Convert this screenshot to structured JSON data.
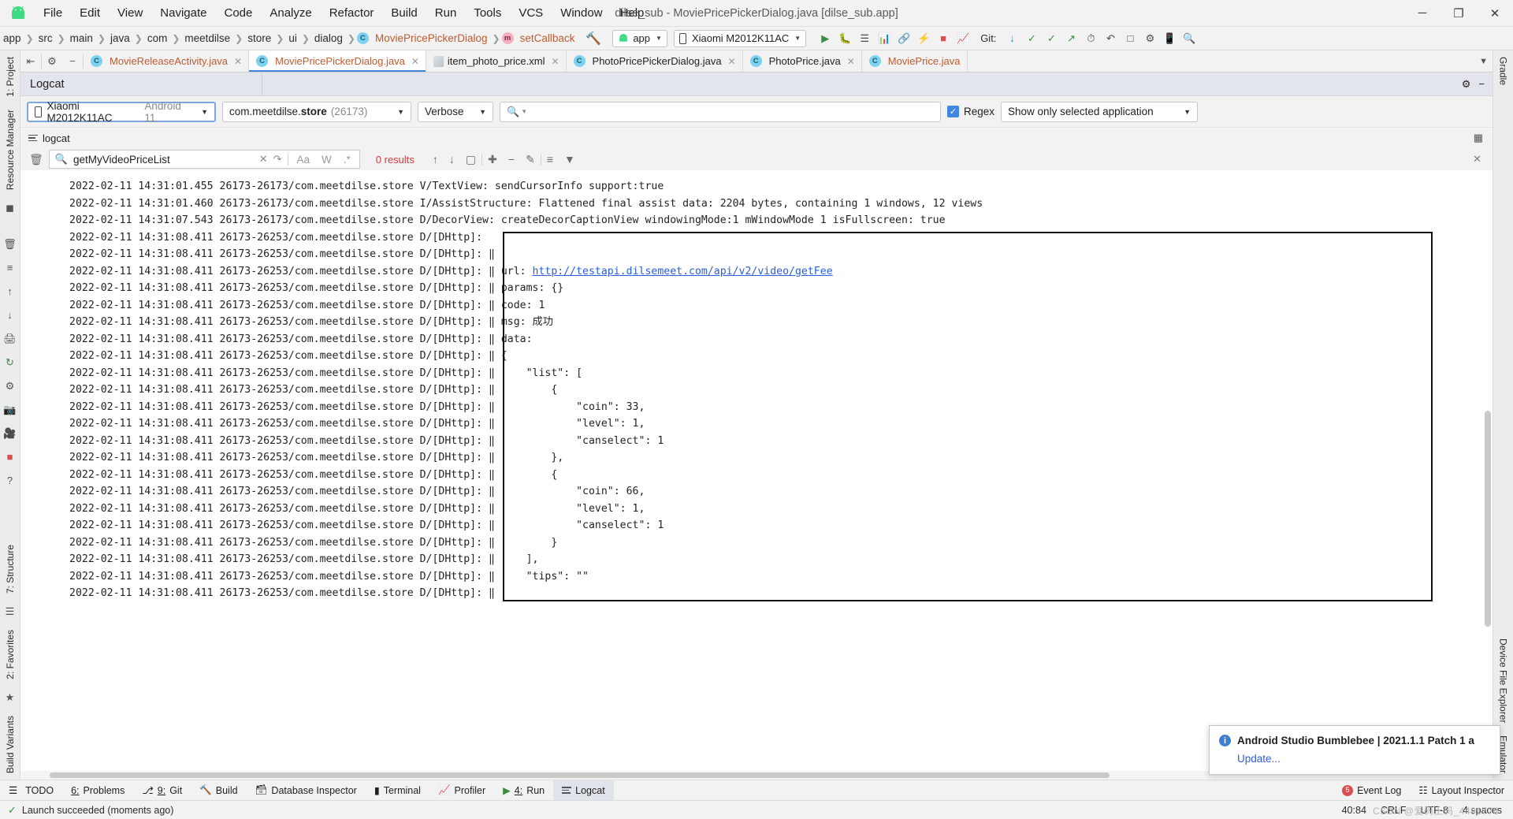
{
  "window": {
    "title": "dilse_sub - MoviePricePickerDialog.java [dilse_sub.app]",
    "minimize": "─",
    "maximize": "❐",
    "close": "✕"
  },
  "menubar": {
    "items": [
      "File",
      "Edit",
      "View",
      "Navigate",
      "Code",
      "Analyze",
      "Refactor",
      "Build",
      "Run",
      "Tools",
      "VCS",
      "Window",
      "Help"
    ]
  },
  "navbar": {
    "crumbs": [
      "app",
      "src",
      "main",
      "java",
      "com",
      "meetdilse",
      "store",
      "ui",
      "dialog"
    ],
    "class_crumb": "MoviePricePickerDialog",
    "method_crumb": "setCallback",
    "run_config": "app",
    "device": "Xiaomi M2012K11AC",
    "git_label": "Git:"
  },
  "editor_tabs": [
    {
      "label": "MovieReleaseActivity.java",
      "icon": "java-class-icon",
      "active": false
    },
    {
      "label": "MoviePricePickerDialog.java",
      "icon": "java-class-icon",
      "active": true
    },
    {
      "label": "item_photo_price.xml",
      "icon": "xml-file-icon",
      "active": false
    },
    {
      "label": "PhotoPricePickerDialog.java",
      "icon": "java-class-icon",
      "active": false
    },
    {
      "label": "PhotoPrice.java",
      "icon": "java-class-icon",
      "active": false
    },
    {
      "label": "MoviePrice.java",
      "icon": "java-class-icon",
      "active": false
    }
  ],
  "logcat": {
    "panel_title": "Logcat",
    "device_filter": "Xiaomi M2012K11AC",
    "device_android": "Android 11",
    "process_filter_pkg": "com.meetdilse.",
    "process_filter_bold": "store",
    "process_filter_pid": "(26173)",
    "level_filter": "Verbose",
    "search_placeholder": "",
    "regex_label": "Regex",
    "scope_filter": "Show only selected application",
    "subtab_label": "logcat",
    "find": {
      "value": "getMyVideoPriceList",
      "match_case": "Aa",
      "words": "W",
      "regex": ".*",
      "results": "0 results"
    }
  },
  "log_lines": [
    {
      "text": "2022-02-11 14:31:01.455 26173-26173/com.meetdilse.store V/TextView: sendCursorInfo support:true"
    },
    {
      "text": "2022-02-11 14:31:01.460 26173-26173/com.meetdilse.store I/AssistStructure: Flattened final assist data: 2204 bytes, containing 1 windows, 12 views"
    },
    {
      "text": "2022-02-11 14:31:07.543 26173-26173/com.meetdilse.store D/DecorView: createDecorCaptionView windowingMode:1 mWindowMode 1 isFullscreen: true"
    },
    {
      "text": "2022-02-11 14:31:08.411 26173-26253/com.meetdilse.store D/[DHttp]: "
    },
    {
      "text": "2022-02-11 14:31:08.411 26173-26253/com.meetdilse.store D/[DHttp]: ‖"
    },
    {
      "text": "2022-02-11 14:31:08.411 26173-26253/com.meetdilse.store D/[DHttp]: ‖ url: ",
      "link": "http://testapi.dilsemeet.com/api/v2/video/getFee"
    },
    {
      "text": "2022-02-11 14:31:08.411 26173-26253/com.meetdilse.store D/[DHttp]: ‖ params: {}"
    },
    {
      "text": "2022-02-11 14:31:08.411 26173-26253/com.meetdilse.store D/[DHttp]: ‖ code: 1"
    },
    {
      "text": "2022-02-11 14:31:08.411 26173-26253/com.meetdilse.store D/[DHttp]: ‖ msg: 成功"
    },
    {
      "text": "2022-02-11 14:31:08.411 26173-26253/com.meetdilse.store D/[DHttp]: ‖ data:"
    },
    {
      "text": "2022-02-11 14:31:08.411 26173-26253/com.meetdilse.store D/[DHttp]: ‖ {"
    },
    {
      "text": "2022-02-11 14:31:08.411 26173-26253/com.meetdilse.store D/[DHttp]: ‖     \"list\": ["
    },
    {
      "text": "2022-02-11 14:31:08.411 26173-26253/com.meetdilse.store D/[DHttp]: ‖         {"
    },
    {
      "text": "2022-02-11 14:31:08.411 26173-26253/com.meetdilse.store D/[DHttp]: ‖             \"coin\": 33,"
    },
    {
      "text": "2022-02-11 14:31:08.411 26173-26253/com.meetdilse.store D/[DHttp]: ‖             \"level\": 1,"
    },
    {
      "text": "2022-02-11 14:31:08.411 26173-26253/com.meetdilse.store D/[DHttp]: ‖             \"canselect\": 1"
    },
    {
      "text": "2022-02-11 14:31:08.411 26173-26253/com.meetdilse.store D/[DHttp]: ‖         },"
    },
    {
      "text": "2022-02-11 14:31:08.411 26173-26253/com.meetdilse.store D/[DHttp]: ‖         {"
    },
    {
      "text": "2022-02-11 14:31:08.411 26173-26253/com.meetdilse.store D/[DHttp]: ‖             \"coin\": 66,"
    },
    {
      "text": "2022-02-11 14:31:08.411 26173-26253/com.meetdilse.store D/[DHttp]: ‖             \"level\": 1,"
    },
    {
      "text": "2022-02-11 14:31:08.411 26173-26253/com.meetdilse.store D/[DHttp]: ‖             \"canselect\": 1"
    },
    {
      "text": "2022-02-11 14:31:08.411 26173-26253/com.meetdilse.store D/[DHttp]: ‖         }"
    },
    {
      "text": "2022-02-11 14:31:08.411 26173-26253/com.meetdilse.store D/[DHttp]: ‖     ],"
    },
    {
      "text": "2022-02-11 14:31:08.411 26173-26253/com.meetdilse.store D/[DHttp]: ‖     \"tips\": \"\""
    },
    {
      "text": "2022-02-11 14:31:08.411 26173-26253/com.meetdilse.store D/[DHttp]: ‖"
    }
  ],
  "left_rail": {
    "tabs": [
      "1: Project",
      "Resource Manager"
    ],
    "bottom_tabs": [
      "7: Structure",
      "2: Favorites",
      "Build Variants"
    ]
  },
  "right_rail": {
    "tabs": [
      "Gradle",
      "Device File Explorer",
      "Emulator"
    ]
  },
  "bottom_bar": {
    "items": [
      {
        "label": "TODO",
        "num": "",
        "icon": "todo-icon"
      },
      {
        "label": "Problems",
        "num": "6:",
        "icon": "problems-icon"
      },
      {
        "label": "Git",
        "num": "9:",
        "icon": "git-icon"
      },
      {
        "label": "Build",
        "num": "",
        "icon": "build-icon"
      },
      {
        "label": "Database Inspector",
        "num": "",
        "icon": "database-icon"
      },
      {
        "label": "Terminal",
        "num": "",
        "icon": "terminal-icon"
      },
      {
        "label": "Profiler",
        "num": "",
        "icon": "profiler-icon"
      },
      {
        "label": "Run",
        "num": "4:",
        "icon": "run-icon"
      },
      {
        "label": "Logcat",
        "num": "",
        "icon": "logcat-icon"
      }
    ],
    "right_items": [
      {
        "label": "Event Log",
        "badge": "5"
      },
      {
        "label": "Layout Inspector",
        "badge": ""
      }
    ]
  },
  "statusbar": {
    "message": "Launch succeeded (moments ago)",
    "caret": "40:84",
    "line_sep": "CRLF",
    "encoding": "UTF-8",
    "indent": "4 spaces"
  },
  "balloon": {
    "title": "Android Studio Bumblebee | 2021.1.1 Patch 1 a",
    "link": "Update..."
  },
  "watermark": "CSDN @爱码上码_4491776"
}
